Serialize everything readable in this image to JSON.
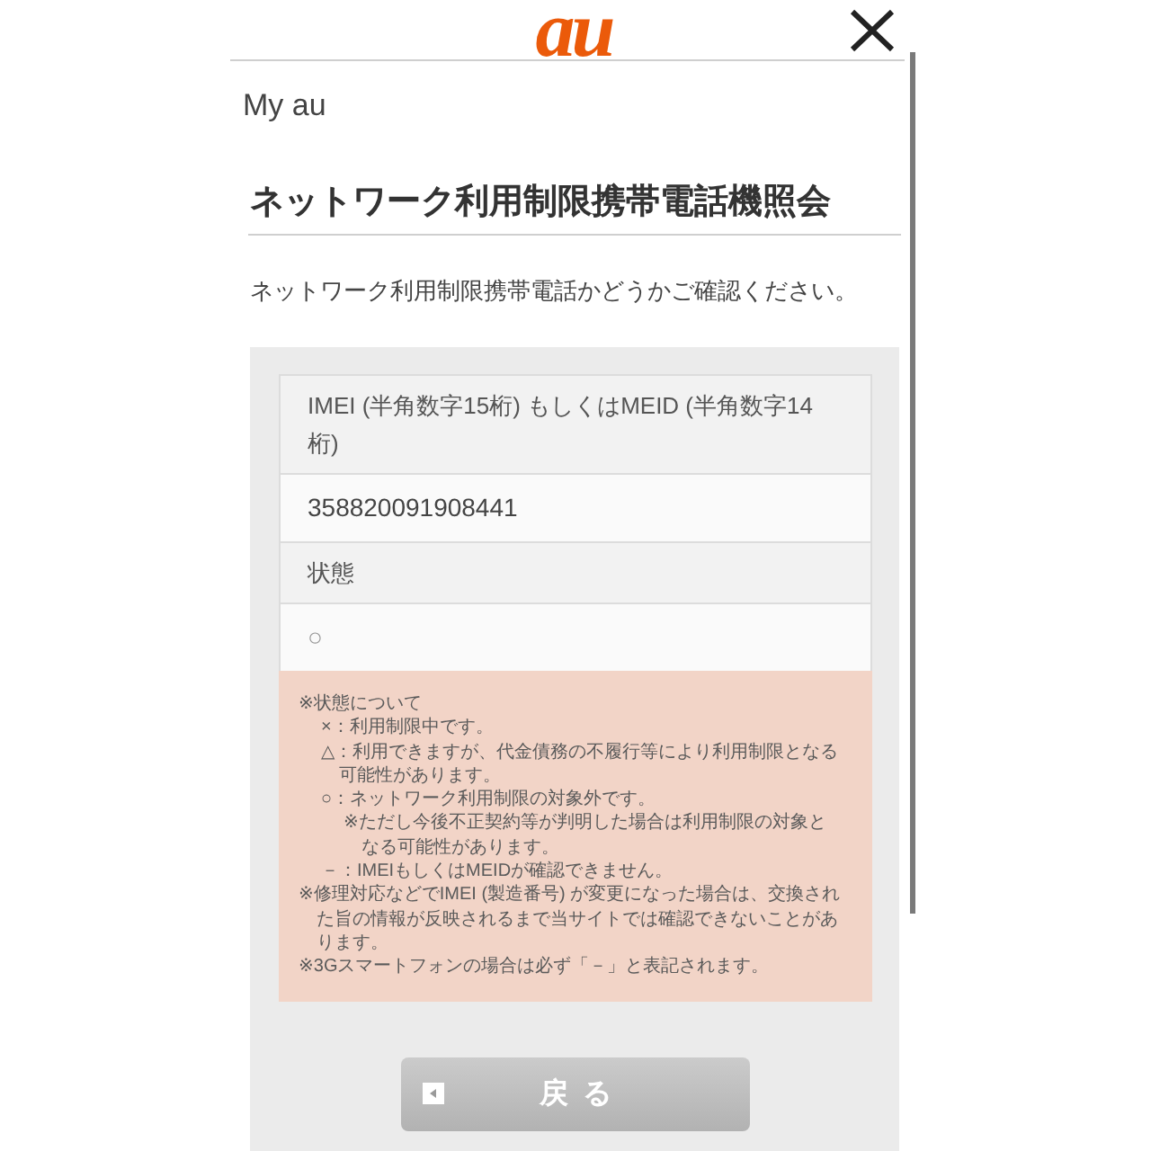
{
  "header": {
    "logo": "au"
  },
  "breadcrumb": "My au",
  "page": {
    "title": "ネットワーク利用制限携帯電話機照会",
    "description": "ネットワーク利用制限携帯電話かどうかご確認ください。"
  },
  "result_table": {
    "rows": [
      {
        "kind": "label",
        "text": "IMEI (半角数字15桁) もしくはMEID (半角数字14桁)"
      },
      {
        "kind": "value",
        "text": "358820091908441"
      },
      {
        "kind": "label",
        "text": "状態"
      },
      {
        "kind": "status",
        "text": "○"
      }
    ],
    "notes": [
      {
        "text": "※状態について",
        "children": [
          {
            "text": "×：利用制限中です。"
          },
          {
            "text": "△：利用できますが、代金債務の不履行等により利用制限となる可能性があります。"
          },
          {
            "text": "○：ネットワーク利用制限の対象外です。",
            "children": [
              {
                "text": "※ただし今後不正契約等が判明した場合は利用制限の対象となる可能性があります。"
              }
            ]
          },
          {
            "text": "－：IMEIもしくはMEIDが確認できません。"
          }
        ]
      },
      {
        "text": "※修理対応などでIMEI (製造番号) が変更になった場合は、交換された旨の情報が反映されるまで当サイトでは確認できないことがあります。"
      },
      {
        "text": "※3Gスマートフォンの場合は必ず「－」と表記されます。"
      }
    ]
  },
  "buttons": [
    {
      "label": "戻る"
    }
  ]
}
